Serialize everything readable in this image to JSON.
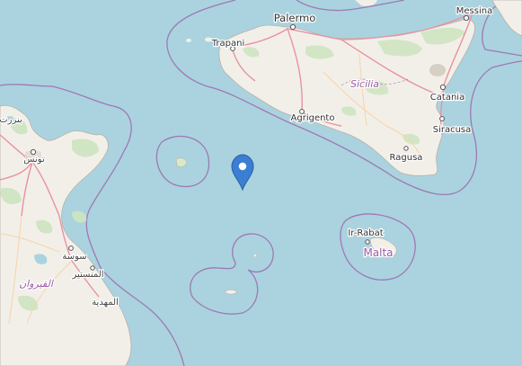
{
  "map": {
    "labels": {
      "palermo": "Palermo",
      "messina": "Messina",
      "trapani": "Trapani",
      "sicilia": "Sicilia",
      "agrigento": "Agrigento",
      "catania": "Catania",
      "siracusa": "Siracusa",
      "ragusa": "Ragusa",
      "ir_rabat": "Ir-Rabat",
      "malta": "Malta",
      "bizerte": "بنزرت",
      "tunis": "تونس",
      "sousse": "سوسة",
      "monastir": "المنستير",
      "kairouan": "القيروان",
      "mahdia": "المهدية"
    },
    "colors": {
      "sea": "#aad3df",
      "land": "#f2efe9",
      "park": "#cde5c0",
      "boundary": "#9b5ba5",
      "road": "#e892a2",
      "marker": "#3b7fd4"
    },
    "marker_icon": "map-pin-icon"
  }
}
